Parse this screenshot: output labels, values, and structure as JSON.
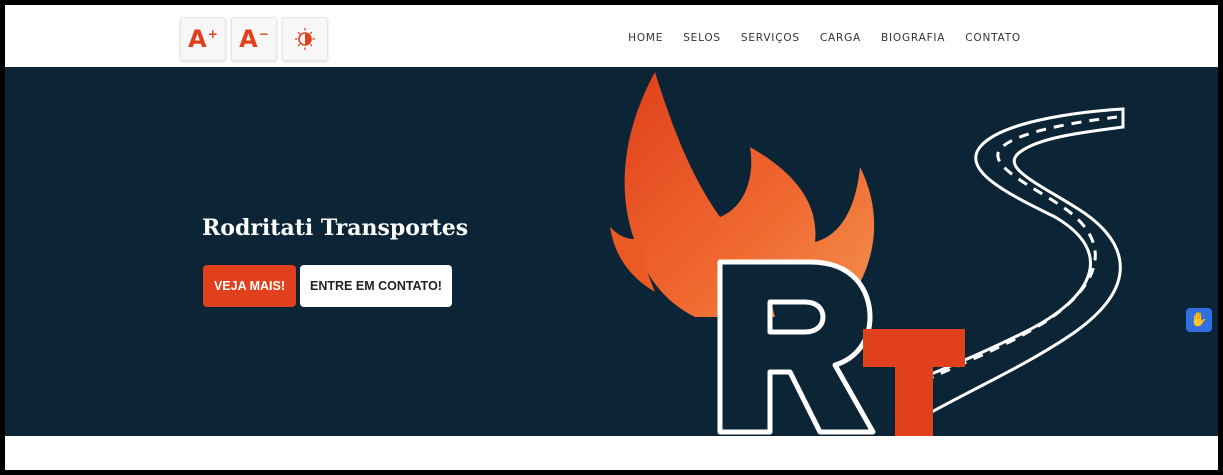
{
  "accessibility": {
    "increase_font_label": "A",
    "increase_font_sup": "+",
    "decrease_font_label": "A",
    "decrease_font_sup": "−"
  },
  "nav": {
    "items": [
      "HOME",
      "SELOS",
      "SERVIÇOS",
      "CARGA",
      "BIOGRAFIA",
      "CONTATO"
    ]
  },
  "hero": {
    "title": "Rodritati Transportes",
    "primary_button": "VEJA MAIS!",
    "secondary_button": "ENTRE EM CONTATO!"
  },
  "colors": {
    "accent": "#e0401b",
    "hero_bg": "#0c2536",
    "libras_blue": "#2f6fe0"
  },
  "icons": {
    "contrast": "contrast-icon",
    "libras": "sign-language-icon"
  }
}
